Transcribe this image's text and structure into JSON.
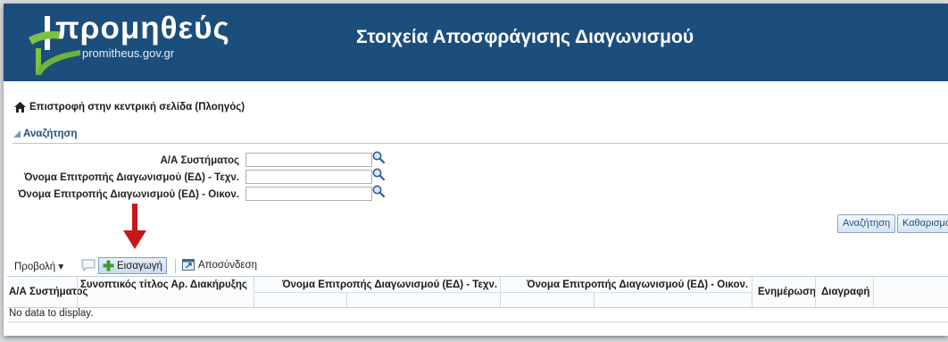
{
  "header": {
    "logo_text": "προμηθεύς",
    "logo_sub": "promitheus.gov.gr",
    "title": "Στοιχεία Αποσφράγισης Διαγωνισμού"
  },
  "nav": {
    "back_link": "Επιστροφή στην κεντρική σελίδα (Πλοηγός)"
  },
  "search": {
    "title": "Αναζήτηση",
    "fields": [
      {
        "label": "Α/Α Συστήματος",
        "value": ""
      },
      {
        "label": "Όνομα Επιτροπής Διαγωνισμού (ΕΔ) - Τεχν.",
        "value": ""
      },
      {
        "label": "Όνομα Επιτροπής Διαγωνισμού (ΕΔ) - Οικον.",
        "value": ""
      }
    ],
    "search_button": "Αναζήτηση",
    "clear_button": "Καθαρισμό"
  },
  "toolbar": {
    "view_label": "Προβολή ▾",
    "insert_label": "Εισαγωγή",
    "disconnect_label": "Αποσύνδεση"
  },
  "table": {
    "columns": [
      "Α/Α Συστήματος",
      "Συνοπτικός τίτλος Αρ. Διακήρυξης",
      "Όνομα Επιτροπής Διαγωνισμού (ΕΔ) - Τεχν.",
      "Όνομα Επιτροπής Διαγωνισμού (ΕΔ) - Οικον.",
      "Ενημέρωση",
      "Διαγραφή"
    ],
    "empty_message": "No data to display."
  },
  "colors": {
    "header_bg": "#1c4e7c",
    "logo_green": "#7dc243",
    "annotation_arrow": "#c8161d"
  }
}
